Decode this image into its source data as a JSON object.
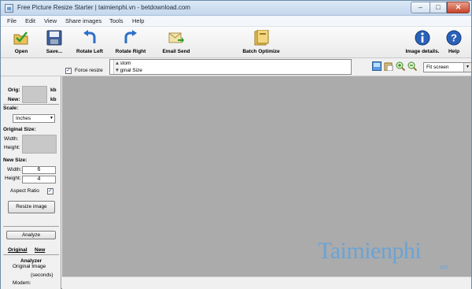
{
  "window": {
    "title": "Free Picture Resize Starter  |  taimienphi.vn - betdownload.com"
  },
  "menu": [
    "File",
    "Edit",
    "View",
    "Share images",
    "Tools",
    "Help"
  ],
  "toolbar": {
    "open": "Open",
    "save": "Save...",
    "rotate_left": "Rotate Left",
    "rotate_right": "Rotate Right",
    "email_send": "Email Send",
    "batch_optimize": "Batch Optimize",
    "image_details": "Image details.",
    "help": "Help"
  },
  "options": {
    "force_resize_label": "Force resize",
    "force_resize_checked": "✓",
    "preset_items": [
      "Custom",
      "Original Size"
    ],
    "fit_value": "Fit screen"
  },
  "left": {
    "orig_label": "Orig:",
    "orig_unit": "kb",
    "new_label": "New:",
    "new_unit": "kb",
    "scale_label": "Scale:",
    "scale_value": "Inches",
    "original_size_title": "Original Size:",
    "width_label": "Width:",
    "height_label": "Height:",
    "new_size_title": "New Size:",
    "new_width_label": "Width:",
    "new_width_value": "6",
    "new_height_label": "Height:",
    "new_height_value": "4",
    "aspect_label": "Aspect Ratio",
    "aspect_checked": "✓",
    "resize_button": "Resize image",
    "analyze_button": "Analyze",
    "tab_original": "Original",
    "tab_new": "New",
    "analyzer_title": "Analyzer",
    "analyzer_line1": "Original Image",
    "analyzer_line2": "(seconds)",
    "modem_label": "Modem:"
  },
  "watermark": {
    "text": "Taimienphi",
    "suffix": ".vn"
  },
  "colors": {
    "canvas": "#ababab",
    "watermark": "#6aa3d6"
  }
}
